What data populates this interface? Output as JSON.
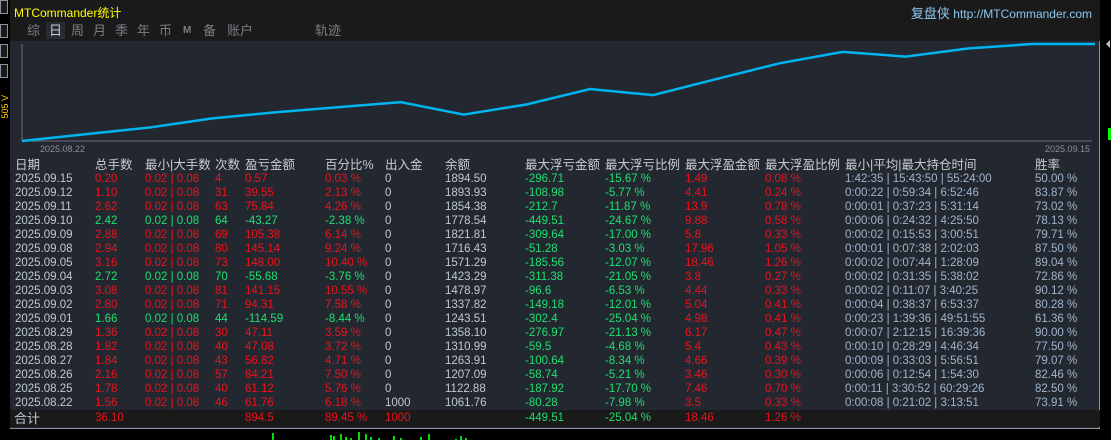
{
  "app": {
    "title": "MTCommander统计",
    "brand_cn": "复盘侠",
    "brand_url": "http://MTCommander.com",
    "side_label": "505 V"
  },
  "tabs": [
    {
      "label": "综"
    },
    {
      "label": "日",
      "active": true
    },
    {
      "label": "周"
    },
    {
      "label": "月"
    },
    {
      "label": "季"
    },
    {
      "label": "年"
    },
    {
      "label": "币"
    },
    {
      "label": "M"
    },
    {
      "label": "备"
    },
    {
      "label": "账户"
    },
    {
      "label": "轨迹"
    }
  ],
  "colors": {
    "profit": "#e8141e",
    "loss": "#1ee070",
    "line": "#00b4f0",
    "title": "#ffff00"
  },
  "chart_data": {
    "type": "line",
    "x_start_label": "2025.08.22",
    "x_end_label": "2025.09.15",
    "x": [
      "2025.08.22",
      "2025.08.25",
      "2025.08.26",
      "2025.08.27",
      "2025.08.28",
      "2025.08.29",
      "2025.09.01",
      "2025.09.02",
      "2025.09.03",
      "2025.09.04",
      "2025.09.05",
      "2025.09.08",
      "2025.09.09",
      "2025.09.10",
      "2025.09.11",
      "2025.09.12",
      "2025.09.15"
    ],
    "values": [
      1061.76,
      1122.88,
      1207.09,
      1263.91,
      1310.99,
      1358.1,
      1243.51,
      1337.82,
      1478.97,
      1423.29,
      1571.29,
      1716.43,
      1821.81,
      1778.54,
      1854.38,
      1893.93,
      1894.5
    ],
    "start_value": 1000
  },
  "table": {
    "headers": [
      "日期",
      "总手数",
      "最小|大手数",
      "次数",
      "盈亏金额",
      "百分比%",
      "出入金",
      "余额",
      "最大浮亏金额",
      "最大浮亏比例",
      "最大浮盈金额",
      "最大浮盈比例",
      "最小|平均|最大持仓时间",
      "胜率"
    ],
    "rows": [
      [
        "2025.09.15",
        "0.20",
        "0.02 | 0.08",
        "4",
        "0.57",
        "0.03 %",
        "0",
        "1894.50",
        "-296.71",
        "-15.67 %",
        "1.49",
        "0.08 %",
        "1:42:35 | 15:43:50 | 55:24:00",
        "50.00 %"
      ],
      [
        "2025.09.12",
        "1.10",
        "0.02 | 0.08",
        "31",
        "39.55",
        "2.13 %",
        "0",
        "1893.93",
        "-108.98",
        "-5.77 %",
        "4.41",
        "0.24 %",
        "0:00:22 | 0:59:34 | 6:52:46",
        "83.87 %"
      ],
      [
        "2025.09.11",
        "2.62",
        "0.02 | 0.08",
        "63",
        "75.84",
        "4.26 %",
        "0",
        "1854.38",
        "-212.7",
        "-11.87 %",
        "13.9",
        "0.78 %",
        "0:00:01 | 0:37:23 | 5:31:14",
        "73.02 %"
      ],
      [
        "2025.09.10",
        "2.42",
        "0.02 | 0.08",
        "64",
        "-43.27",
        "-2.38 %",
        "0",
        "1778.54",
        "-449.51",
        "-24.67 %",
        "9.88",
        "0.58 %",
        "0:00:06 | 0:24:32 | 4:25:50",
        "78.13 %"
      ],
      [
        "2025.09.09",
        "2.88",
        "0.02 | 0.08",
        "69",
        "105.38",
        "6.14 %",
        "0",
        "1821.81",
        "-309.64",
        "-17.00 %",
        "5.8",
        "0.33 %",
        "0:00:02 | 0:15:53 | 3:00:51",
        "79.71 %"
      ],
      [
        "2025.09.08",
        "2.94",
        "0.02 | 0.08",
        "80",
        "145.14",
        "9.24 %",
        "0",
        "1716.43",
        "-51.28",
        "-3.03 %",
        "17.96",
        "1.05 %",
        "0:00:01 | 0:07:38 | 2:02:03",
        "87.50 %"
      ],
      [
        "2025.09.05",
        "3.16",
        "0.02 | 0.08",
        "73",
        "148.00",
        "10.40 %",
        "0",
        "1571.29",
        "-185.56",
        "-12.07 %",
        "18.46",
        "1.26 %",
        "0:00:02 | 0:07:44 | 1:28:09",
        "89.04 %"
      ],
      [
        "2025.09.04",
        "2.72",
        "0.02 | 0.08",
        "70",
        "-55.68",
        "-3.76 %",
        "0",
        "1423.29",
        "-311.38",
        "-21.05 %",
        "3.8",
        "0.27 %",
        "0:00:02 | 0:31:35 | 5:38:02",
        "72.86 %"
      ],
      [
        "2025.09.03",
        "3.08",
        "0.02 | 0.08",
        "81",
        "141.15",
        "10.55 %",
        "0",
        "1478.97",
        "-96.6",
        "-6.53 %",
        "4.44",
        "0.33 %",
        "0:00:02 | 0:11:07 | 3:40:25",
        "90.12 %"
      ],
      [
        "2025.09.02",
        "2.80",
        "0.02 | 0.08",
        "71",
        "94.31",
        "7.58 %",
        "0",
        "1337.82",
        "-149.18",
        "-12.01 %",
        "5.04",
        "0.41 %",
        "0:00:04 | 0:38:37 | 6:53:37",
        "80.28 %"
      ],
      [
        "2025.09.01",
        "1.66",
        "0.02 | 0.08",
        "44",
        "-114.59",
        "-8.44 %",
        "0",
        "1243.51",
        "-302.4",
        "-25.04 %",
        "4.98",
        "0.41 %",
        "0:00:23 | 1:39:36 | 49:51:55",
        "61.36 %"
      ],
      [
        "2025.08.29",
        "1.36",
        "0.02 | 0.08",
        "30",
        "47.11",
        "3.59 %",
        "0",
        "1358.10",
        "-276.97",
        "-21.13 %",
        "6.17",
        "0.47 %",
        "0:00:07 | 2:12:15 | 16:39:36",
        "90.00 %"
      ],
      [
        "2025.08.28",
        "1.82",
        "0.02 | 0.08",
        "40",
        "47.08",
        "3.72 %",
        "0",
        "1310.99",
        "-59.5",
        "-4.68 %",
        "5.4",
        "0.43 %",
        "0:00:10 | 0:28:29 | 4:46:34",
        "77.50 %"
      ],
      [
        "2025.08.27",
        "1.84",
        "0.02 | 0.08",
        "43",
        "56.82",
        "4.71 %",
        "0",
        "1263.91",
        "-100.64",
        "-8.34 %",
        "4.66",
        "0.39 %",
        "0:00:09 | 0:33:03 | 5:56:51",
        "79.07 %"
      ],
      [
        "2025.08.26",
        "2.16",
        "0.02 | 0.08",
        "57",
        "84.21",
        "7.50 %",
        "0",
        "1207.09",
        "-58.74",
        "-5.21 %",
        "3.46",
        "0.30 %",
        "0:00:06 | 0:12:54 | 1:54:30",
        "82.46 %"
      ],
      [
        "2025.08.25",
        "1.78",
        "0.02 | 0.08",
        "40",
        "61.12",
        "5.76 %",
        "0",
        "1122.88",
        "-187.92",
        "-17.70 %",
        "7.46",
        "0.70 %",
        "0:00:11 | 3:30:52 | 60:29:26",
        "82.50 %"
      ],
      [
        "2025.08.22",
        "1.56",
        "0.02 | 0.08",
        "46",
        "61.76",
        "6.18 %",
        "1000",
        "1061.76",
        "-80.28",
        "-7.98 %",
        "3.5",
        "0.33 %",
        "0:00:08 | 0:21:02 | 3:13:51",
        "73.91 %"
      ]
    ],
    "total": {
      "label": "合计",
      "lots": "36.10",
      "pnl": "894.5",
      "pct": "89.45 %",
      "deposit": "1000",
      "max_float_loss": "-449.51",
      "max_float_loss_pct": "-25.04 %",
      "max_float_profit": "18.46",
      "max_float_profit_pct": "1.26 %"
    }
  }
}
